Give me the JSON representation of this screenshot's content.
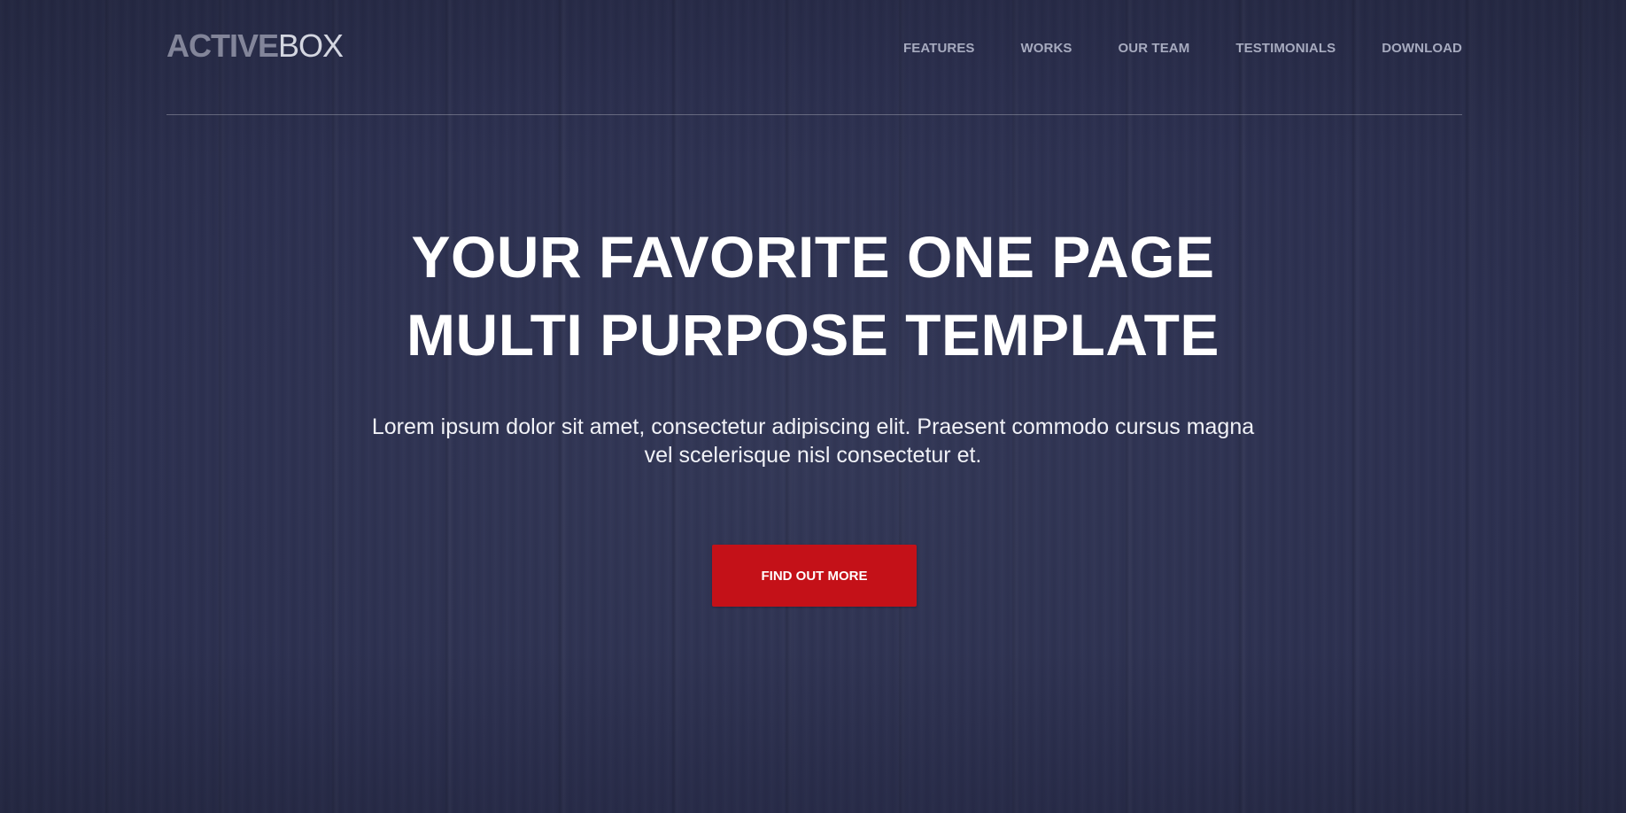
{
  "brand": {
    "logo_bold": "ACTIVE",
    "logo_light": "BOX"
  },
  "nav": {
    "items": [
      {
        "label": "FEATURES"
      },
      {
        "label": "WORKS"
      },
      {
        "label": "OUR TEAM"
      },
      {
        "label": "TESTIMONIALS"
      },
      {
        "label": "DOWNLOAD"
      }
    ]
  },
  "hero": {
    "title_line1": "YOUR FAVORITE ONE PAGE",
    "title_line2": "MULTI PURPOSE TEMPLATE",
    "subtitle_line1": "Lorem ipsum dolor sit amet, consectetur adipiscing elit. Praesent commodo cursus magna",
    "subtitle_line2": "vel scelerisque nisl consectetur et.",
    "cta_label": "FIND OUT MORE"
  },
  "colors": {
    "background": "#2f3350",
    "accent": "#c41118",
    "nav_text": "#a7abbf",
    "title_text": "#ffffff"
  }
}
